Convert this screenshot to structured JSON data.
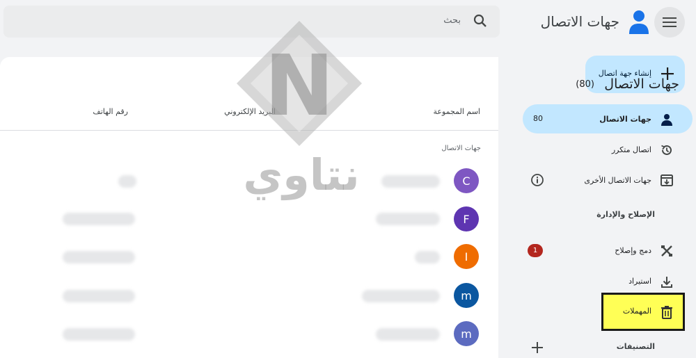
{
  "app": {
    "title": "جهات الاتصال"
  },
  "search": {
    "placeholder": "بحث"
  },
  "sidebar": {
    "create_label": "إنشاء جهة اتصال",
    "items": [
      {
        "label": "جهات الاتصال",
        "count": "80"
      },
      {
        "label": "اتصال متكرر"
      },
      {
        "label": "جهات الاتصال الأخرى"
      }
    ],
    "fix_section": "الإصلاح والإدارة",
    "fix_items": [
      {
        "label": "دمج وإصلاح",
        "badge": "1"
      },
      {
        "label": "استيراد"
      },
      {
        "label": "المهملات"
      }
    ],
    "labels_section": "التصنيفات"
  },
  "main": {
    "title": "جهات الاتصال",
    "count": "(80)",
    "columns": {
      "name": "اسم المجموعة",
      "email": "البريد الإلكتروني",
      "phone": "رقم الهاتف"
    },
    "group_label": "جهات الاتصال",
    "rows": [
      {
        "initial": "C",
        "color": "#7e57c2"
      },
      {
        "initial": "F",
        "color": "#5e35b1"
      },
      {
        "initial": "I",
        "color": "#ef6c00"
      },
      {
        "initial": "m",
        "color": "#0b57a0"
      },
      {
        "initial": "m",
        "color": "#5c6bc0"
      }
    ]
  },
  "watermark": {
    "text": "نتاوي",
    "letter": "N"
  }
}
